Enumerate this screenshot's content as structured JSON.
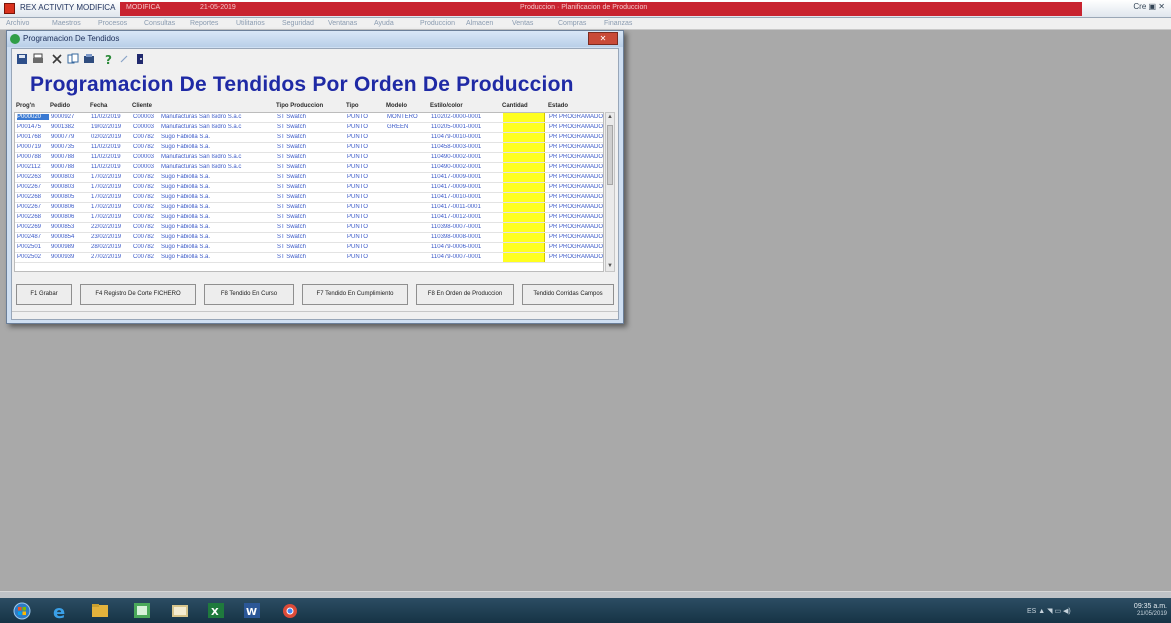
{
  "app": {
    "title": "REX ACTIVITY MODIFICA",
    "band_left": "MODIFICA",
    "band_mid": "21-05-2019",
    "band_right": "Produccion · Planificacion de Produccion",
    "controls": "Cre ▣ ✕",
    "accent_red": "#c8232f"
  },
  "menu": [
    "Archivo",
    "Maestros",
    "Procesos",
    "Consultas",
    "Reportes",
    "Utilitarios",
    "Seguridad",
    "Ventanas",
    "Ayuda",
    "Produccion",
    "Almacen",
    "Ventas",
    "Compras",
    "Finanzas"
  ],
  "window": {
    "title": "Programacion De Tendidos",
    "close": "✕",
    "form_title": "Programacion De Tendidos Por Orden De Produccion"
  },
  "toolbar": [
    "save-icon",
    "print-icon",
    "delete-icon",
    "copy-icon",
    "export-icon",
    "help-icon",
    "search-icon",
    "exit-icon"
  ],
  "grid": {
    "columns": [
      "Prog'n",
      "Pedido",
      "Fecha",
      "Cliente",
      "Tipo Produccion",
      "Tipo",
      "Modelo",
      "Estilo/color",
      "Cantidad",
      "Estado"
    ],
    "rows": [
      [
        "P000020",
        "9000927",
        "11/02/2019",
        "C00003",
        "Manufacturas San Isidro S.a.c",
        "ST Swatch",
        "PUNTO",
        "MONTERO",
        "110202-0000-0001",
        "",
        "PR PROGRAMADO"
      ],
      [
        "P001475",
        "9001382",
        "19/02/2019",
        "C00003",
        "Manufacturas San Isidro S.a.c",
        "ST Swatch",
        "PUNTO",
        "GREEN",
        "110205-0001-0001",
        "",
        "PR PROGRAMADO"
      ],
      [
        "P001768",
        "9000779",
        "02/02/2019",
        "C00782",
        "Sugo Fabiolla S.a.",
        "ST Swatch",
        "PUNTO",
        "",
        "110479-0010-0001",
        "",
        "PR PROGRAMADO"
      ],
      [
        "P000719",
        "9000735",
        "11/02/2019",
        "C00782",
        "Sugo Fabiolla S.a.",
        "ST Swatch",
        "PUNTO",
        "",
        "110458-0003-0001",
        "",
        "PR PROGRAMADO"
      ],
      [
        "P000788",
        "9000788",
        "11/02/2019",
        "C00003",
        "Manufacturas San Isidro S.a.c",
        "ST Swatch",
        "PUNTO",
        "",
        "110490-0002-0001",
        "",
        "PR PROGRAMADO"
      ],
      [
        "P002112",
        "9000788",
        "11/02/2019",
        "C00003",
        "Manufacturas San Isidro S.a.c",
        "ST Swatch",
        "PUNTO",
        "",
        "110490-0002-0001",
        "",
        "PR PROGRAMADO"
      ],
      [
        "P002263",
        "9000803",
        "17/02/2019",
        "C00782",
        "Sugo Fabiolla S.a.",
        "ST Swatch",
        "PUNTO",
        "",
        "110417-0009-0001",
        "",
        "PR PROGRAMADO"
      ],
      [
        "P002267",
        "9000803",
        "17/02/2019",
        "C00782",
        "Sugo Fabiolla S.a.",
        "ST Swatch",
        "PUNTO",
        "",
        "110417-0009-0001",
        "",
        "PR PROGRAMADO"
      ],
      [
        "P002268",
        "9000805",
        "17/02/2019",
        "C00782",
        "Sugo Fabiolla S.a.",
        "ST Swatch",
        "PUNTO",
        "",
        "110417-0010-0001",
        "",
        "PR PROGRAMADO"
      ],
      [
        "P002267",
        "9000806",
        "17/02/2019",
        "C00782",
        "Sugo Fabiolla S.a.",
        "ST Swatch",
        "PUNTO",
        "",
        "110417-0011-0001",
        "",
        "PR PROGRAMADO"
      ],
      [
        "P002268",
        "9000806",
        "17/02/2019",
        "C00782",
        "Sugo Fabiolla S.a.",
        "ST Swatch",
        "PUNTO",
        "",
        "110417-0012-0001",
        "",
        "PR PROGRAMADO"
      ],
      [
        "P002269",
        "9000853",
        "22/02/2019",
        "C00782",
        "Sugo Fabiolla S.a.",
        "ST Swatch",
        "PUNTO",
        "",
        "110398-0007-0001",
        "",
        "PR PROGRAMADO"
      ],
      [
        "P002487",
        "9000854",
        "23/02/2019",
        "C00782",
        "Sugo Fabiolla S.a.",
        "ST Swatch",
        "PUNTO",
        "",
        "110398-0008-0001",
        "",
        "PR PROGRAMADO"
      ],
      [
        "P002501",
        "9000989",
        "28/02/2019",
        "C00782",
        "Sugo Fabiolla S.a.",
        "ST Swatch",
        "PUNTO",
        "",
        "110479-0006-0001",
        "",
        "PR PROGRAMADO"
      ],
      [
        "P002502",
        "9000939",
        "27/02/2019",
        "C00782",
        "Sugo Fabiolla S.a.",
        "ST Swatch",
        "PUNTO",
        "",
        "110479-0007-0001",
        "",
        "PR PROGRAMADO"
      ]
    ],
    "qty_color": "#ffff20"
  },
  "buttons": [
    "F1 Grabar",
    "F4 Registro De Corte FICHERO",
    "F8 Tendido En Curso",
    "F7 Tendido En Cumplimiento",
    "F8 En Orden de Produccion",
    "Tendido Corridas Campos"
  ],
  "taskbar": {
    "apps": [
      "start-orb",
      "ie-icon",
      "explorer-icon",
      "app-green-icon",
      "folder-icon",
      "excel-icon",
      "word-icon",
      "chrome-icon"
    ],
    "tray": "ES ▲ ◥ ▭ ◀)",
    "time": "09:35 a.m.",
    "date": "21/05/2019"
  }
}
